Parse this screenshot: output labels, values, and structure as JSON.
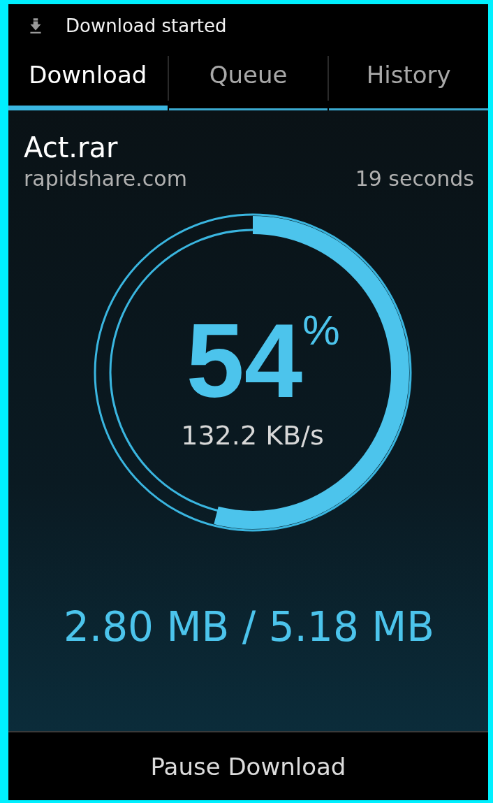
{
  "status_bar": {
    "notification": "Download started"
  },
  "tabs": [
    {
      "label": "Download",
      "selected": true
    },
    {
      "label": "Queue",
      "selected": false
    },
    {
      "label": "History",
      "selected": false
    }
  ],
  "download": {
    "filename": "Act.rar",
    "host": "rapidshare.com",
    "time_remaining": "19 seconds",
    "progress": {
      "percent": "54",
      "unit": "%"
    },
    "speed": "132.2 KB/s",
    "size": "2.80 MB / 5.18 MB"
  },
  "button": "Pause Download"
}
